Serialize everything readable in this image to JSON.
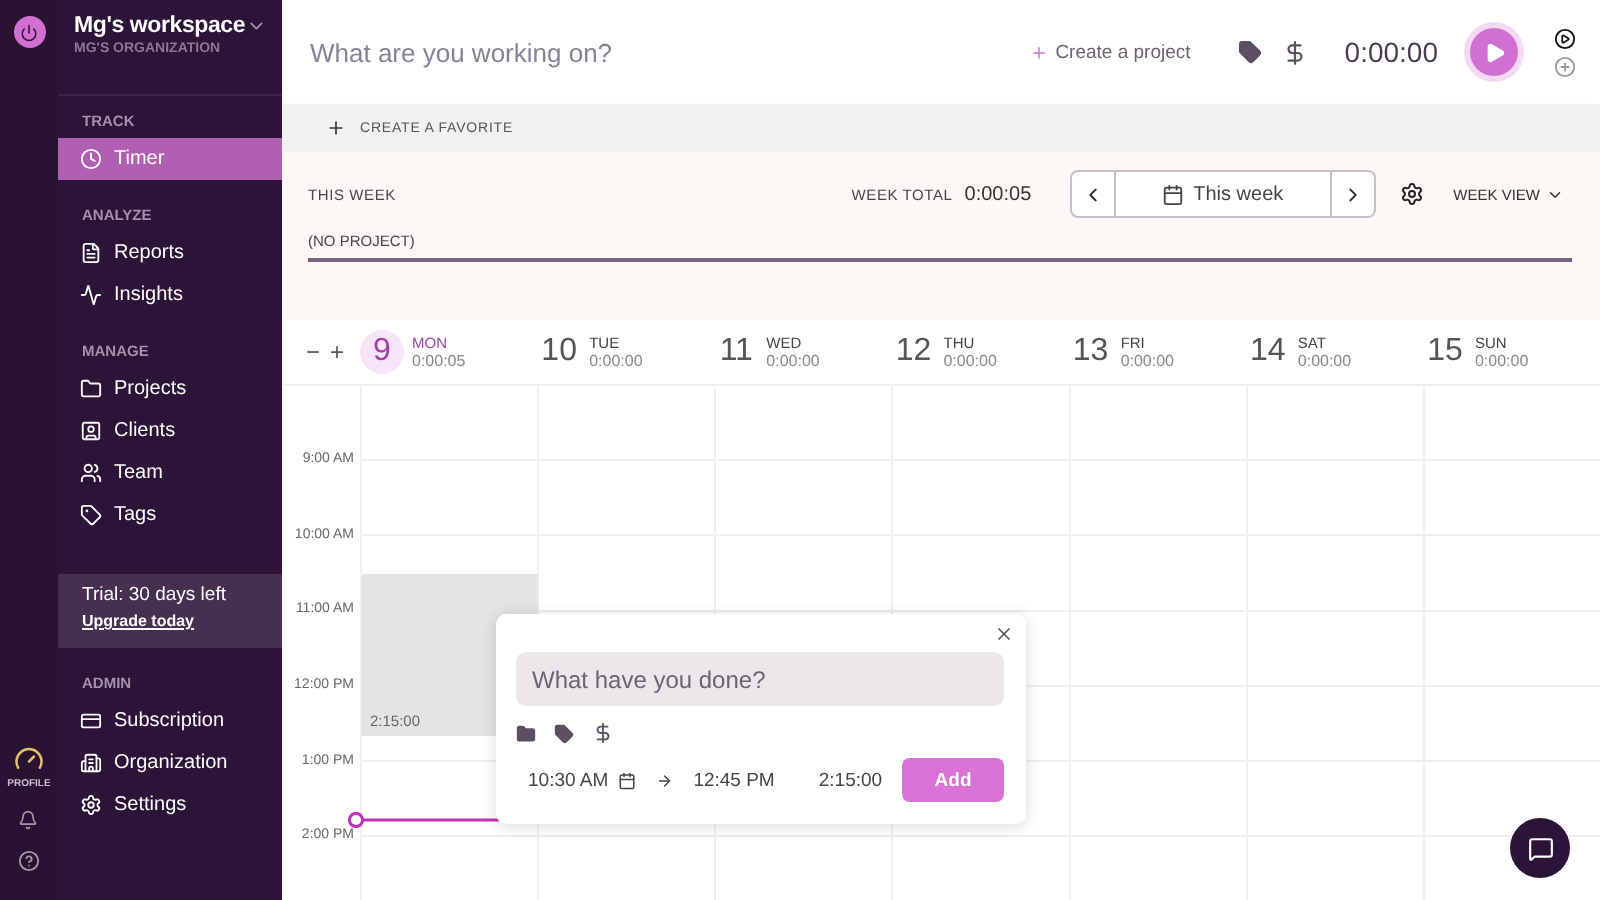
{
  "rail": {
    "profile_label": "PROFILE"
  },
  "workspace": {
    "name": "Mg's workspace",
    "organization": "MG'S ORGANIZATION"
  },
  "sidebar": {
    "sections": [
      {
        "title": "TRACK",
        "items": [
          {
            "label": "Timer",
            "kind": "timer",
            "selected": true
          }
        ]
      },
      {
        "title": "ANALYZE",
        "items": [
          {
            "label": "Reports",
            "kind": "reports",
            "selected": false
          },
          {
            "label": "Insights",
            "kind": "insights",
            "selected": false
          }
        ]
      },
      {
        "title": "MANAGE",
        "items": [
          {
            "label": "Projects",
            "kind": "projects",
            "selected": false
          },
          {
            "label": "Clients",
            "kind": "clients",
            "selected": false
          },
          {
            "label": "Team",
            "kind": "team",
            "selected": false
          },
          {
            "label": "Tags",
            "kind": "tags",
            "selected": false
          }
        ]
      }
    ],
    "trial": {
      "text": "Trial: 30 days left",
      "link": "Upgrade today"
    },
    "admin": {
      "title": "ADMIN",
      "items": [
        {
          "label": "Subscription",
          "kind": "subscription",
          "selected": false
        },
        {
          "label": "Organization",
          "kind": "organization",
          "selected": false
        },
        {
          "label": "Settings",
          "kind": "settings",
          "selected": false
        }
      ]
    }
  },
  "timer_bar": {
    "placeholder": "What are you working on?",
    "create_project": "Create a project",
    "time": "0:00:00"
  },
  "favorites": {
    "label": "CREATE A FAVORITE"
  },
  "week": {
    "label": "THIS WEEK",
    "total_label": "WEEK TOTAL",
    "total": "0:00:05",
    "range": "This week",
    "view": "WEEK VIEW",
    "project": "(NO PROJECT)"
  },
  "zoom": {
    "minus": "−",
    "plus": "+"
  },
  "days": [
    {
      "number": "9",
      "name": "MON",
      "total": "0:00:05",
      "selected": true
    },
    {
      "number": "10",
      "name": "TUE",
      "total": "0:00:00",
      "selected": false
    },
    {
      "number": "11",
      "name": "WED",
      "total": "0:00:00",
      "selected": false
    },
    {
      "number": "12",
      "name": "THU",
      "total": "0:00:00",
      "selected": false
    },
    {
      "number": "13",
      "name": "FRI",
      "total": "0:00:00",
      "selected": false
    },
    {
      "number": "14",
      "name": "SAT",
      "total": "0:00:00",
      "selected": false
    },
    {
      "number": "15",
      "name": "SUN",
      "total": "0:00:00",
      "selected": false
    }
  ],
  "times": [
    "9:00 AM",
    "10:00 AM",
    "11:00 AM",
    "12:00 PM",
    "1:00 PM",
    "2:00 PM"
  ],
  "entry": {
    "duration": "2:15:00"
  },
  "popup": {
    "placeholder": "What have you done?",
    "start": "10:30 AM",
    "end": "12:45 PM",
    "duration": "2:15:00",
    "add": "Add"
  }
}
